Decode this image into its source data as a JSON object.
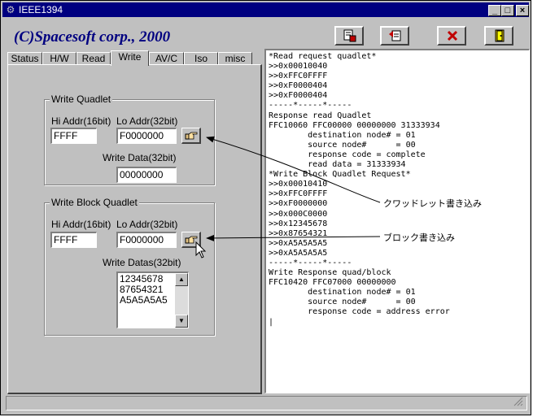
{
  "window": {
    "title": "IEEE1394",
    "app_icon": "gear-icon",
    "controls": [
      "minimize-icon",
      "maximize-icon",
      "close-icon"
    ]
  },
  "header": {
    "brand": "(C)Spacesoft corp., 2000"
  },
  "toolbar": {
    "buttons": [
      {
        "name": "save-button",
        "icon": "save-disk-icon"
      },
      {
        "name": "open-button",
        "icon": "open-icon"
      },
      {
        "name": "clear-button",
        "icon": "red-x-icon"
      },
      {
        "name": "exit-button",
        "icon": "exit-door-icon"
      }
    ]
  },
  "tabs": [
    {
      "label": "Status",
      "active": false
    },
    {
      "label": "H/W",
      "active": false
    },
    {
      "label": "Read",
      "active": false
    },
    {
      "label": "Write",
      "active": true
    },
    {
      "label": "AV/C",
      "active": false
    },
    {
      "label": "Iso",
      "active": false
    },
    {
      "label": "misc",
      "active": false
    }
  ],
  "write_quadlet": {
    "title": "Write Quadlet",
    "hi_label": "Hi Addr(16bit)",
    "lo_label": "Lo Addr(32bit)",
    "hi_value": "FFFF",
    "lo_value": "F0000000",
    "data_label": "Write Data(32bit)",
    "data_value": "00000000",
    "button_icon": "pointing-hand-icon"
  },
  "write_block": {
    "title": "Write Block Quadlet",
    "hi_label": "Hi Addr(16bit)",
    "lo_label": "Lo Addr(32bit)",
    "hi_value": "FFFF",
    "lo_value": "F0000000",
    "datas_label": "Write Datas(32bit)",
    "datas": [
      "12345678",
      "87654321",
      "A5A5A5A5"
    ],
    "button_icon": "pointing-hand-icon"
  },
  "log": {
    "lines": [
      "*Read request quadlet*",
      ">>0x00010040",
      ">>0xFFC0FFFF",
      ">>0xF0000404",
      ">>0xF0000404",
      "-----*-----*-----",
      "Response read Quadlet",
      "FFC10060 FFC00000 00000000 31333934",
      "        destination node# = 01",
      "        source node#      = 00",
      "        response code = complete",
      "        read data = 31333934",
      "*Write Block Quadlet Request*",
      ">>0x00010410",
      ">>0xFFC0FFFF",
      ">>0xF0000000",
      ">>0x000C0000",
      ">>0x12345678",
      ">>0x87654321",
      ">>0xA5A5A5A5",
      ">>0xA5A5A5A5",
      "-----*-----*-----",
      "Write Response quad/block",
      "FFC10420 FFC07000 00000000",
      "        destination node# = 01",
      "        source node#      = 00",
      "        response code = address error",
      "|"
    ]
  },
  "annotations": {
    "quadlet": "クワッドレット書き込み",
    "block": "ブロック書き込み"
  }
}
